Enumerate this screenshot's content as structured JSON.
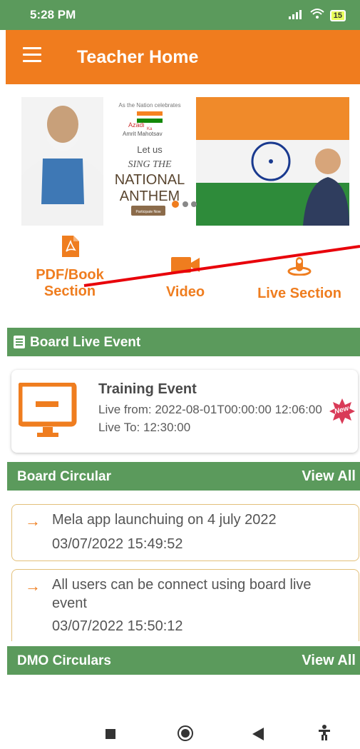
{
  "status": {
    "time": "5:28 PM",
    "battery": "15"
  },
  "appbar": {
    "title": "Teacher Home"
  },
  "banner": {
    "top_line": "As the Nation celebrates",
    "azadi_line1": "Azadi",
    "azadi_ka": "Ka",
    "azadi_line2": "Amrit Mahotsav",
    "let_us": "Let us",
    "sing_the": "SING THE",
    "national": "NATIONAL",
    "anthem": "ANTHEM",
    "participate": "Participate Now"
  },
  "quick_links": {
    "pdf": "PDF/Book Section",
    "video": "Video",
    "live": "Live Section"
  },
  "board_live": {
    "header": "Board Live Event",
    "event_title": "Training Event",
    "live_from": "Live from: 2022-08-01T00:00:00 12:06:00",
    "live_to": "Live To: 12:30:00",
    "badge": "New"
  },
  "board_circular": {
    "header": "Board Circular",
    "view_all": "View All",
    "items": [
      {
        "text": "Mela app launchuing on 4 july 2022",
        "date": "03/07/2022 15:49:52"
      },
      {
        "text": "All users can be connect using board live event",
        "date": "03/07/2022 15:50:12"
      }
    ]
  },
  "dmo": {
    "header": "DMO Circulars",
    "view_all": "View All"
  },
  "colors": {
    "orange": "#f07c1e",
    "green": "#5b9a5c",
    "annotation_red": "#e8000a"
  }
}
